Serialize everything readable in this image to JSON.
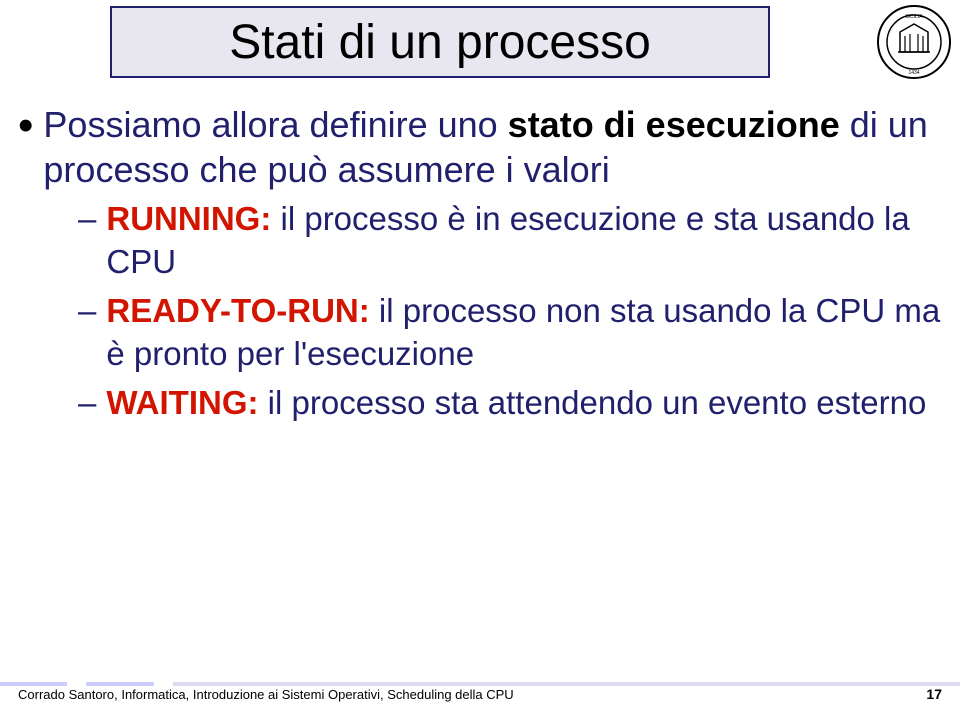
{
  "title": "Stati di un processo",
  "main_bullet_prefix": "Possiamo allora definire uno ",
  "main_bullet_bold": "stato di esecuzione",
  "main_bullet_suffix": " di un processo che può assumere i valori",
  "sub1_label": "RUNNING:",
  "sub1_text": " il processo è in esecuzione e sta usando la CPU",
  "sub2_label": "READY-TO-RUN:",
  "sub2_text": " il processo non sta usando la CPU ma è pronto per l'esecuzione",
  "sub3_label": "WAITING:",
  "sub3_text": " il processo sta attendendo un evento esterno",
  "footer_left": "Corrado Santoro, Informatica, Introduzione ai Sistemi Operativi, Scheduling della CPU",
  "footer_right": "17"
}
